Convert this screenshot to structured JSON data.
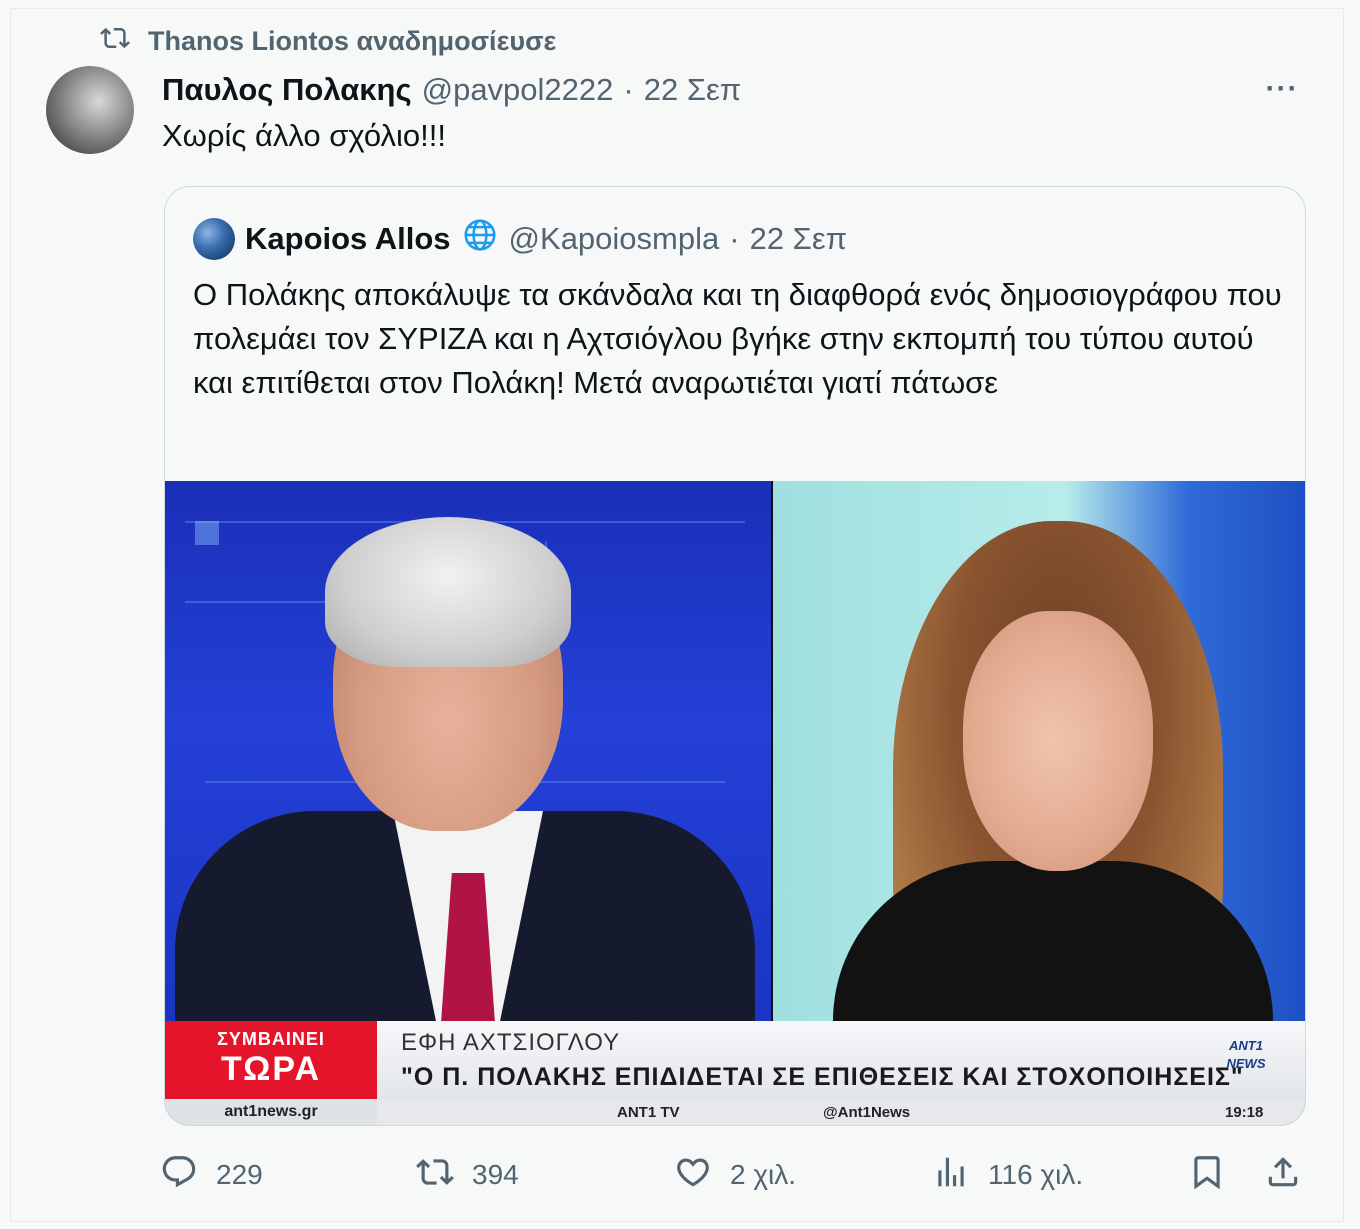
{
  "repost": {
    "user": "Thanos Liontos",
    "action": "αναδημοσίευσε"
  },
  "tweet": {
    "author_name": "Παυλος Πολακης",
    "handle": "@pavpol2222",
    "separator": "·",
    "date": "22 Σεπ",
    "more": "···",
    "text": "Χωρίς άλλο  σχόλιο!!!"
  },
  "quote": {
    "author_name": "Kapoios Allos",
    "handle": "@Kapoiosmpla",
    "separator": "·",
    "date": "22 Σεπ",
    "text": "Ο Πολάκης αποκάλυψε τα σκάνδαλα και τη διαφθορά ενός δημοσιογράφου που πολεμάει τον ΣΥΡΙΖΑ και η Αχτσιόγλου βγήκε στην εκπομπή του τύπου αυτού και επιτίθεται στον Πολάκη! Μετά αναρωτιέται γιατί πάτωσε"
  },
  "media": {
    "ticker_small": "ΣΥΜΒΑΙΝΕΙ",
    "ticker_big": "ΤΩΡΑ",
    "ticker_url": "ant1news.gr",
    "ticker_name": "ΕΦΗ ΑΧΤΣΙΟΓΛΟΥ",
    "ticker_quote": "\"Ο Π. ΠΟΛΑΚΗΣ ΕΠΙΔΙΔΕΤΑΙ ΣΕ ΕΠΙΘΕΣΕΙΣ ΚΑΙ ΣΤΟΧΟΠΟΙΗΣΕΙΣ\"",
    "ticker_logo": "ANT1 NEWS",
    "footer_tv": "ANT1 TV",
    "footer_ig": "@Ant1News",
    "footer_time": "19:18"
  },
  "actions": {
    "replies": "229",
    "reposts": "394",
    "likes": "2 χιλ.",
    "views": "116 χιλ."
  },
  "colors": {
    "muted": "#536471",
    "accent": "#1d9bf0",
    "ticker_red": "#e4152b"
  }
}
